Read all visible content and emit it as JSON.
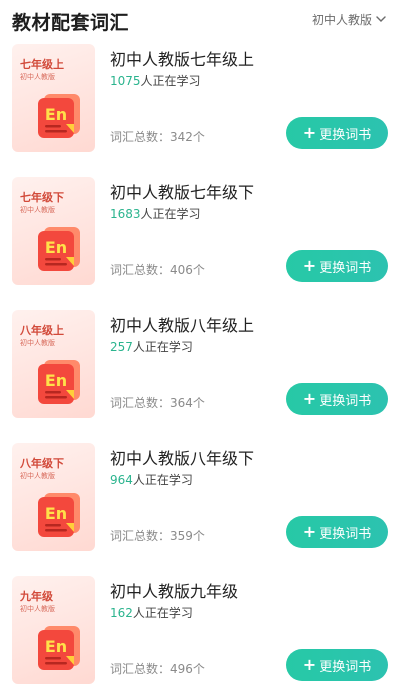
{
  "header": {
    "title": "教材配套词汇",
    "filter_label": "初中人教版"
  },
  "books": [
    {
      "cover_grade": "七年级上",
      "cover_edition": "初中人教版",
      "name": "初中人教版七年级上",
      "learner_count": "1075",
      "learner_suffix": "人正在学习",
      "total": "词汇总数：342个",
      "button": "更换词书"
    },
    {
      "cover_grade": "七年级下",
      "cover_edition": "初中人教版",
      "name": "初中人教版七年级下",
      "learner_count": "1683",
      "learner_suffix": "人正在学习",
      "total": "词汇总数：406个",
      "button": "更换词书"
    },
    {
      "cover_grade": "八年级上",
      "cover_edition": "初中人教版",
      "name": "初中人教版八年级上",
      "learner_count": "257",
      "learner_suffix": "人正在学习",
      "total": "词汇总数：364个",
      "button": "更换词书"
    },
    {
      "cover_grade": "八年级下",
      "cover_edition": "初中人教版",
      "name": "初中人教版八年级下",
      "learner_count": "964",
      "learner_suffix": "人正在学习",
      "total": "词汇总数：359个",
      "button": "更换词书"
    },
    {
      "cover_grade": "九年级",
      "cover_edition": "初中人教版",
      "name": "初中人教版九年级",
      "learner_count": "162",
      "learner_suffix": "人正在学习",
      "total": "词汇总数：496个",
      "button": "更换词书"
    }
  ],
  "cover_icon_text": "En",
  "colors": {
    "accent": "#2bb48e",
    "button": "#27c9a6",
    "cover_title": "#d24a3a"
  }
}
